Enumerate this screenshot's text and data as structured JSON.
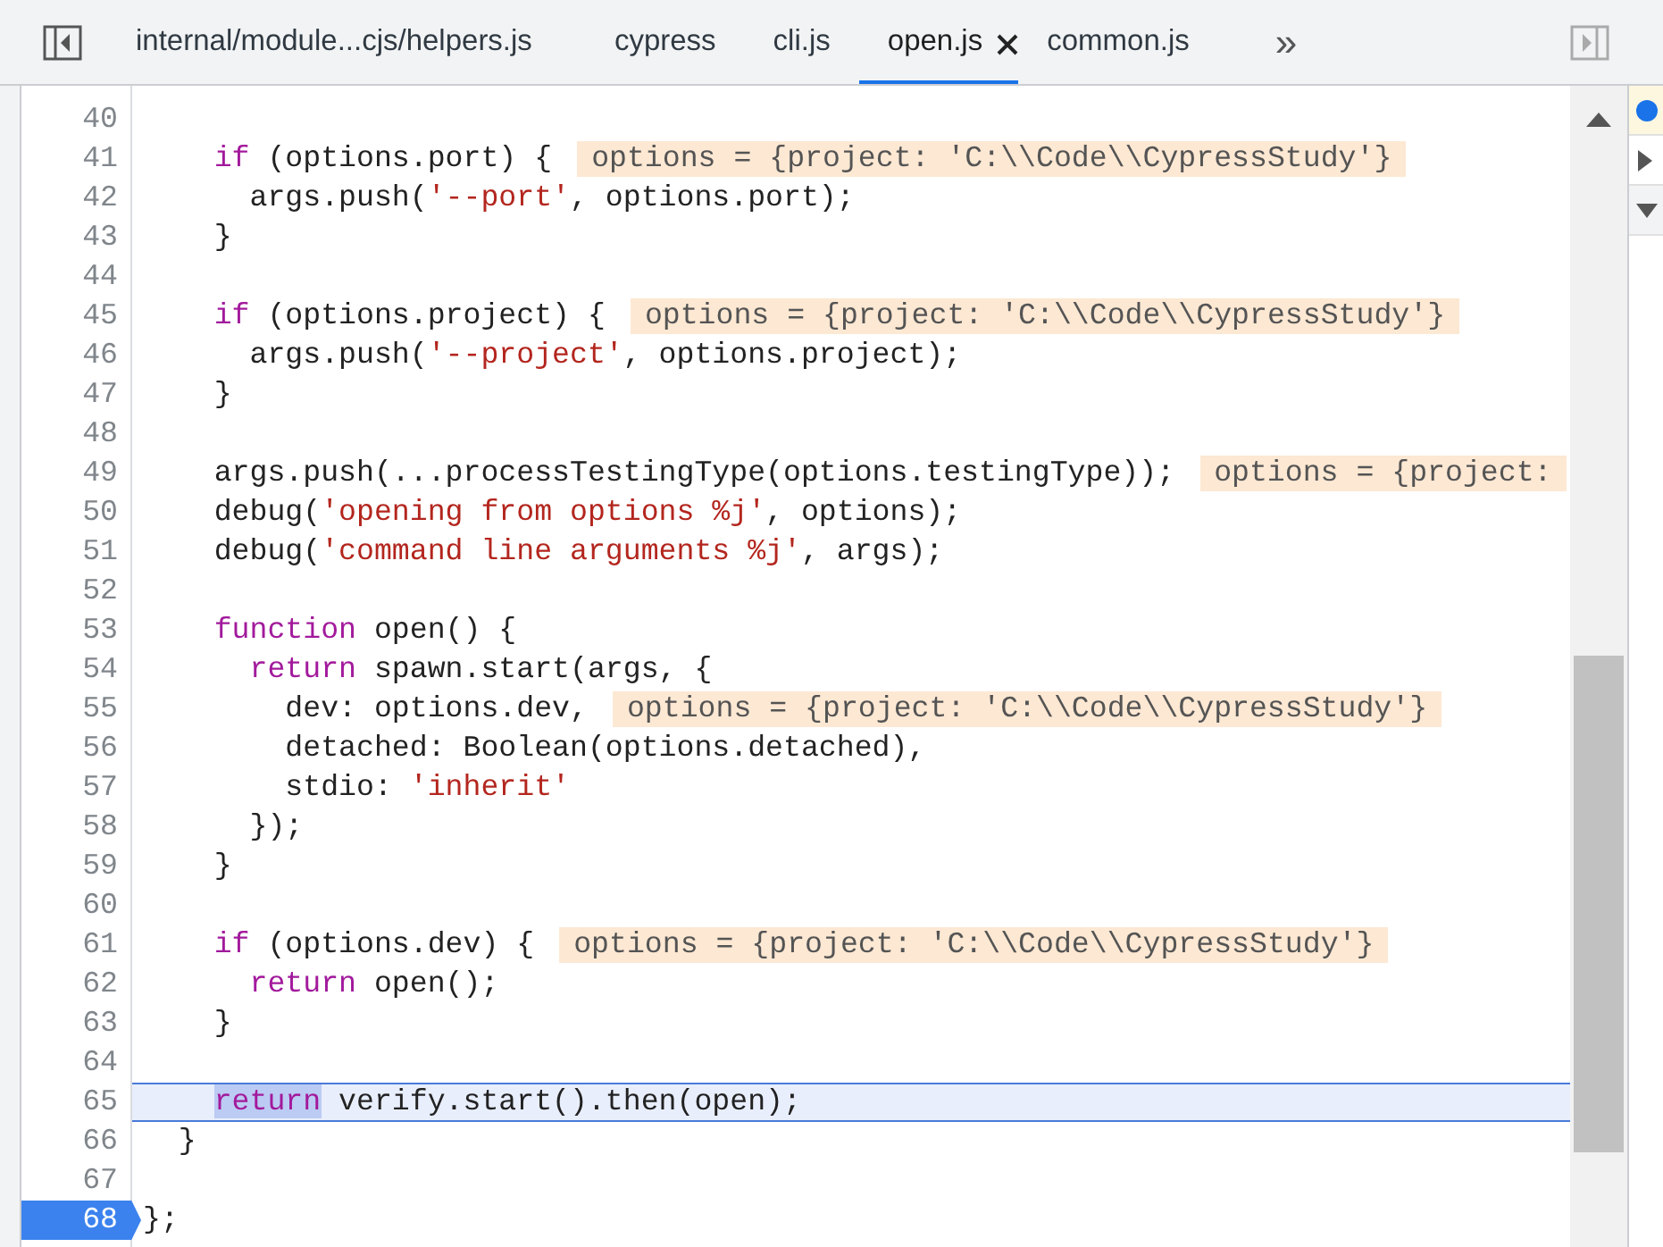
{
  "tabs": [
    {
      "label": "internal/module...cjs/helpers.js",
      "selected": false,
      "closable": false
    },
    {
      "label": "cypress",
      "selected": false,
      "closable": false
    },
    {
      "label": "cli.js",
      "selected": false,
      "closable": false
    },
    {
      "label": "open.js",
      "selected": true,
      "closable": true
    },
    {
      "label": "common.js",
      "selected": false,
      "closable": false
    }
  ],
  "overflow_label": "»",
  "lines": [
    {
      "number": "40",
      "breakpoint": false,
      "current": false
    },
    {
      "number": "41",
      "breakpoint": false,
      "current": false,
      "segments": [
        {
          "kind": "keyword",
          "text": "    if"
        },
        {
          "kind": "plain",
          "text": " (options.port) {"
        }
      ],
      "inline_value": "options = {project: 'C:\\\\Code\\\\CypressStudy'}"
    },
    {
      "number": "42",
      "breakpoint": false,
      "current": false,
      "segments": [
        {
          "kind": "plain",
          "text": "      args.push("
        },
        {
          "kind": "string",
          "text": "'--port'"
        },
        {
          "kind": "plain",
          "text": ", options.port);"
        }
      ]
    },
    {
      "number": "43",
      "breakpoint": false,
      "current": false,
      "segments": [
        {
          "kind": "plain",
          "text": "    }"
        }
      ]
    },
    {
      "number": "44",
      "breakpoint": false,
      "current": false
    },
    {
      "number": "45",
      "breakpoint": false,
      "current": false,
      "segments": [
        {
          "kind": "keyword",
          "text": "    if"
        },
        {
          "kind": "plain",
          "text": " (options.project) {"
        }
      ],
      "inline_value": "options = {project: 'C:\\\\Code\\\\CypressStudy'}"
    },
    {
      "number": "46",
      "breakpoint": false,
      "current": false,
      "segments": [
        {
          "kind": "plain",
          "text": "      args.push("
        },
        {
          "kind": "string",
          "text": "'--project'"
        },
        {
          "kind": "plain",
          "text": ", options.project);"
        }
      ]
    },
    {
      "number": "47",
      "breakpoint": false,
      "current": false,
      "segments": [
        {
          "kind": "plain",
          "text": "    }"
        }
      ]
    },
    {
      "number": "48",
      "breakpoint": false,
      "current": false
    },
    {
      "number": "49",
      "breakpoint": false,
      "current": false,
      "segments": [
        {
          "kind": "plain",
          "text": "    args.push(...processTestingType(options.testingType));"
        }
      ],
      "inline_value": "options = {project:"
    },
    {
      "number": "50",
      "breakpoint": false,
      "current": false,
      "segments": [
        {
          "kind": "plain",
          "text": "    debug("
        },
        {
          "kind": "string",
          "text": "'opening from options %j'"
        },
        {
          "kind": "plain",
          "text": ", options);"
        }
      ]
    },
    {
      "number": "51",
      "breakpoint": false,
      "current": false,
      "segments": [
        {
          "kind": "plain",
          "text": "    debug("
        },
        {
          "kind": "string",
          "text": "'command line arguments %j'"
        },
        {
          "kind": "plain",
          "text": ", args);"
        }
      ]
    },
    {
      "number": "52",
      "breakpoint": false,
      "current": false
    },
    {
      "number": "53",
      "breakpoint": false,
      "current": false,
      "segments": [
        {
          "kind": "keyword",
          "text": "    function"
        },
        {
          "kind": "plain",
          "text": " open() {"
        }
      ]
    },
    {
      "number": "54",
      "breakpoint": false,
      "current": false,
      "segments": [
        {
          "kind": "keyword",
          "text": "      return"
        },
        {
          "kind": "plain",
          "text": " spawn.start(args, {"
        }
      ]
    },
    {
      "number": "55",
      "breakpoint": false,
      "current": false,
      "segments": [
        {
          "kind": "plain",
          "text": "        dev: options.dev,"
        }
      ],
      "inline_value": "options = {project: 'C:\\\\Code\\\\CypressStudy'}"
    },
    {
      "number": "56",
      "breakpoint": false,
      "current": false,
      "segments": [
        {
          "kind": "plain",
          "text": "        detached: Boolean(options.detached),"
        }
      ]
    },
    {
      "number": "57",
      "breakpoint": false,
      "current": false,
      "segments": [
        {
          "kind": "plain",
          "text": "        stdio: "
        },
        {
          "kind": "string",
          "text": "'inherit'"
        }
      ]
    },
    {
      "number": "58",
      "breakpoint": false,
      "current": false,
      "segments": [
        {
          "kind": "plain",
          "text": "      });"
        }
      ]
    },
    {
      "number": "59",
      "breakpoint": false,
      "current": false,
      "segments": [
        {
          "kind": "plain",
          "text": "    }"
        }
      ]
    },
    {
      "number": "60",
      "breakpoint": false,
      "current": false
    },
    {
      "number": "61",
      "breakpoint": false,
      "current": false,
      "segments": [
        {
          "kind": "keyword",
          "text": "    if"
        },
        {
          "kind": "plain",
          "text": " (options.dev) {"
        }
      ],
      "inline_value": "options = {project: 'C:\\\\Code\\\\CypressStudy'}"
    },
    {
      "number": "62",
      "breakpoint": false,
      "current": false,
      "segments": [
        {
          "kind": "keyword",
          "text": "      return"
        },
        {
          "kind": "plain",
          "text": " open();"
        }
      ]
    },
    {
      "number": "63",
      "breakpoint": false,
      "current": false,
      "segments": [
        {
          "kind": "plain",
          "text": "    }"
        }
      ]
    },
    {
      "number": "64",
      "breakpoint": false,
      "current": false
    },
    {
      "number": "65",
      "breakpoint": false,
      "current": true,
      "segments": [
        {
          "kind": "keyword-selected",
          "text": "    return"
        },
        {
          "kind": "plain",
          "text": " verify.start().then(open);"
        }
      ]
    },
    {
      "number": "66",
      "breakpoint": false,
      "current": false,
      "segments": [
        {
          "kind": "plain",
          "text": "  }"
        }
      ]
    },
    {
      "number": "67",
      "breakpoint": false,
      "current": false
    },
    {
      "number": "68",
      "breakpoint": true,
      "current": false,
      "segments": [
        {
          "kind": "plain",
          "text": "};"
        }
      ]
    }
  ]
}
